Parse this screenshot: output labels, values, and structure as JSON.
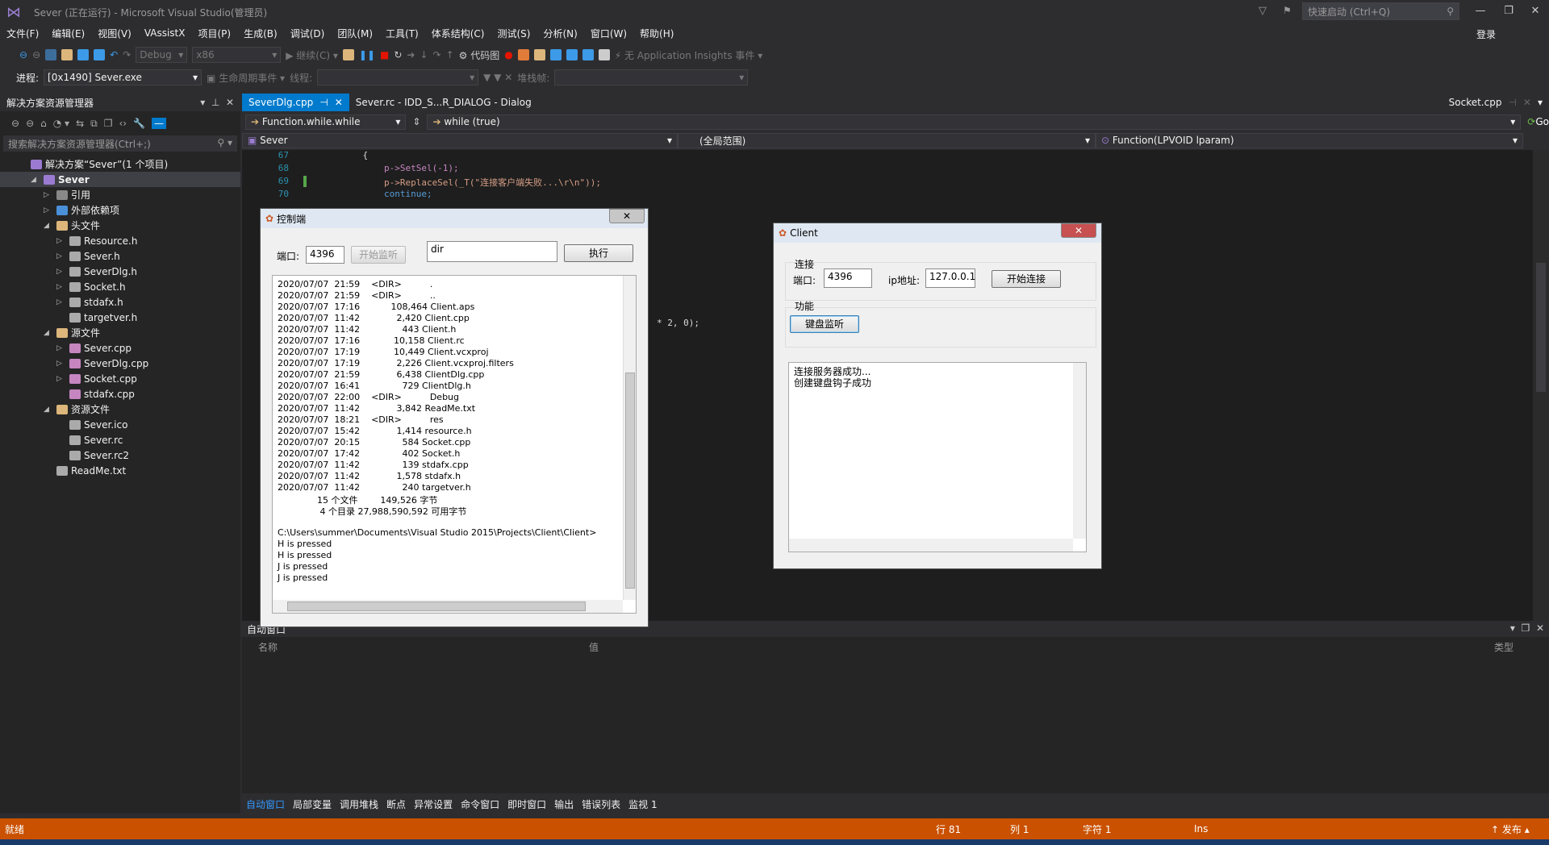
{
  "window": {
    "title": "Sever (正在运行) - Microsoft Visual Studio(管理员)",
    "quick_launch": "快速启动 (Ctrl+Q)",
    "login": "登录"
  },
  "menu": [
    "文件(F)",
    "编辑(E)",
    "视图(V)",
    "VAssistX",
    "项目(P)",
    "生成(B)",
    "调试(D)",
    "团队(M)",
    "工具(T)",
    "体系结构(C)",
    "测试(S)",
    "分析(N)",
    "窗口(W)",
    "帮助(H)"
  ],
  "toolbar": {
    "config": "Debug",
    "platform": "x86",
    "continue": "继续(C)",
    "code_map": "代码图",
    "insights": "无 Application Insights 事件"
  },
  "process": {
    "label": "进程:",
    "value": "[0x1490] Sever.exe",
    "lifecycle": "生命周期事件",
    "thread": "线程:",
    "stack": "堆栈帧:"
  },
  "solution_explorer": {
    "title": "解决方案资源管理器",
    "search": "搜索解决方案资源管理器(Ctrl+;)",
    "items": [
      {
        "label": "解决方案“Sever”(1 个项目)",
        "indent": 0,
        "arrow": "",
        "icon": "#9b7bd1"
      },
      {
        "label": "Sever",
        "indent": 1,
        "arrow": "◢",
        "icon": "#9b7bd1",
        "bold": true
      },
      {
        "label": "引用",
        "indent": 2,
        "arrow": "▷",
        "icon": "#888"
      },
      {
        "label": "外部依赖项",
        "indent": 2,
        "arrow": "▷",
        "icon": "#4a90d9"
      },
      {
        "label": "头文件",
        "indent": 2,
        "arrow": "◢",
        "icon": "#dcb67a"
      },
      {
        "label": "Resource.h",
        "indent": 3,
        "arrow": "▷",
        "icon": "#aaa"
      },
      {
        "label": "Sever.h",
        "indent": 3,
        "arrow": "▷",
        "icon": "#aaa"
      },
      {
        "label": "SeverDlg.h",
        "indent": 3,
        "arrow": "▷",
        "icon": "#aaa"
      },
      {
        "label": "Socket.h",
        "indent": 3,
        "arrow": "▷",
        "icon": "#aaa"
      },
      {
        "label": "stdafx.h",
        "indent": 3,
        "arrow": "▷",
        "icon": "#aaa"
      },
      {
        "label": "targetver.h",
        "indent": 3,
        "arrow": "",
        "icon": "#aaa"
      },
      {
        "label": "源文件",
        "indent": 2,
        "arrow": "◢",
        "icon": "#dcb67a"
      },
      {
        "label": "Sever.cpp",
        "indent": 3,
        "arrow": "▷",
        "icon": "#c586c0"
      },
      {
        "label": "SeverDlg.cpp",
        "indent": 3,
        "arrow": "▷",
        "icon": "#c586c0"
      },
      {
        "label": "Socket.cpp",
        "indent": 3,
        "arrow": "▷",
        "icon": "#c586c0"
      },
      {
        "label": "stdafx.cpp",
        "indent": 3,
        "arrow": "",
        "icon": "#c586c0"
      },
      {
        "label": "资源文件",
        "indent": 2,
        "arrow": "◢",
        "icon": "#dcb67a"
      },
      {
        "label": "Sever.ico",
        "indent": 3,
        "arrow": "",
        "icon": "#aaa"
      },
      {
        "label": "Sever.rc",
        "indent": 3,
        "arrow": "",
        "icon": "#aaa"
      },
      {
        "label": "Sever.rc2",
        "indent": 3,
        "arrow": "",
        "icon": "#aaa"
      },
      {
        "label": "ReadMe.txt",
        "indent": 2,
        "arrow": "",
        "icon": "#aaa"
      }
    ]
  },
  "tabs": {
    "t1": "SeverDlg.cpp",
    "t2": "Sever.rc - IDD_S...R_DIALOG - Dialog",
    "t3": "Socket.cpp"
  },
  "nav": {
    "func": "Function.while.while",
    "scope": "while (true)",
    "go": "Go",
    "class": "Sever",
    "global": "(全局范围)",
    "member": "Function(LPVOID lparam)"
  },
  "code": {
    "lines": [
      {
        "n": "67",
        "t": "            {"
      },
      {
        "n": "68",
        "t": "                p->SetSel(-1);"
      },
      {
        "n": "69",
        "t": "                p->ReplaceSel(_T(\"连接客户端失败...\\r\\n\"));"
      },
      {
        "n": "70",
        "t": "                continue;"
      }
    ],
    "fragment": "* 2, 0);"
  },
  "auto_window": {
    "title": "自动窗口",
    "col_name": "名称",
    "col_value": "值",
    "col_type": "类型"
  },
  "bottom_tabs": [
    "自动窗口",
    "局部变量",
    "调用堆栈",
    "断点",
    "异常设置",
    "命令窗口",
    "即时窗口",
    "输出",
    "错误列表",
    "监视 1"
  ],
  "status": {
    "ready": "就绪",
    "row": "行 81",
    "col": "列 1",
    "ch": "字符 1",
    "ins": "Ins",
    "publish": "发布"
  },
  "console_dlg": {
    "title": "控制端",
    "port_label": "端口:",
    "port": "4396",
    "listen": "开始监听",
    "command": "dir",
    "execute": "执行",
    "output": [
      "2020/07/07  21:59    <DIR>          .",
      "2020/07/07  21:59    <DIR>          ..",
      "2020/07/07  17:16           108,464 Client.aps",
      "2020/07/07  11:42             2,420 Client.cpp",
      "2020/07/07  11:42               443 Client.h",
      "2020/07/07  17:16            10,158 Client.rc",
      "2020/07/07  17:19            10,449 Client.vcxproj",
      "2020/07/07  17:19             2,226 Client.vcxproj.filters",
      "2020/07/07  21:59             6,438 ClientDlg.cpp",
      "2020/07/07  16:41               729 ClientDlg.h",
      "2020/07/07  22:00    <DIR>          Debug",
      "2020/07/07  11:42             3,842 ReadMe.txt",
      "2020/07/07  18:21    <DIR>          res",
      "2020/07/07  15:42             1,414 resource.h",
      "2020/07/07  20:15               584 Socket.cpp",
      "2020/07/07  17:42               402 Socket.h",
      "2020/07/07  11:42               139 stdafx.cpp",
      "2020/07/07  11:42             1,578 stdafx.h",
      "2020/07/07  11:42               240 targetver.h",
      "              15 个文件        149,526 字节",
      "               4 个目录 27,988,590,592 可用字节",
      "",
      "C:\\Users\\summer\\Documents\\Visual Studio 2015\\Projects\\Client\\Client>",
      "H is pressed",
      "H is pressed",
      "J is pressed",
      "J is pressed"
    ]
  },
  "client_dlg": {
    "title": "Client",
    "group_connect": "连接",
    "port_label": "端口:",
    "port": "4396",
    "ip_label": "ip地址:",
    "ip": "127.0.0.1",
    "connect": "开始连接",
    "group_func": "功能",
    "keyboard": "键盘监听",
    "log": [
      "连接服务器成功...",
      "创建键盘钩子成功"
    ]
  }
}
